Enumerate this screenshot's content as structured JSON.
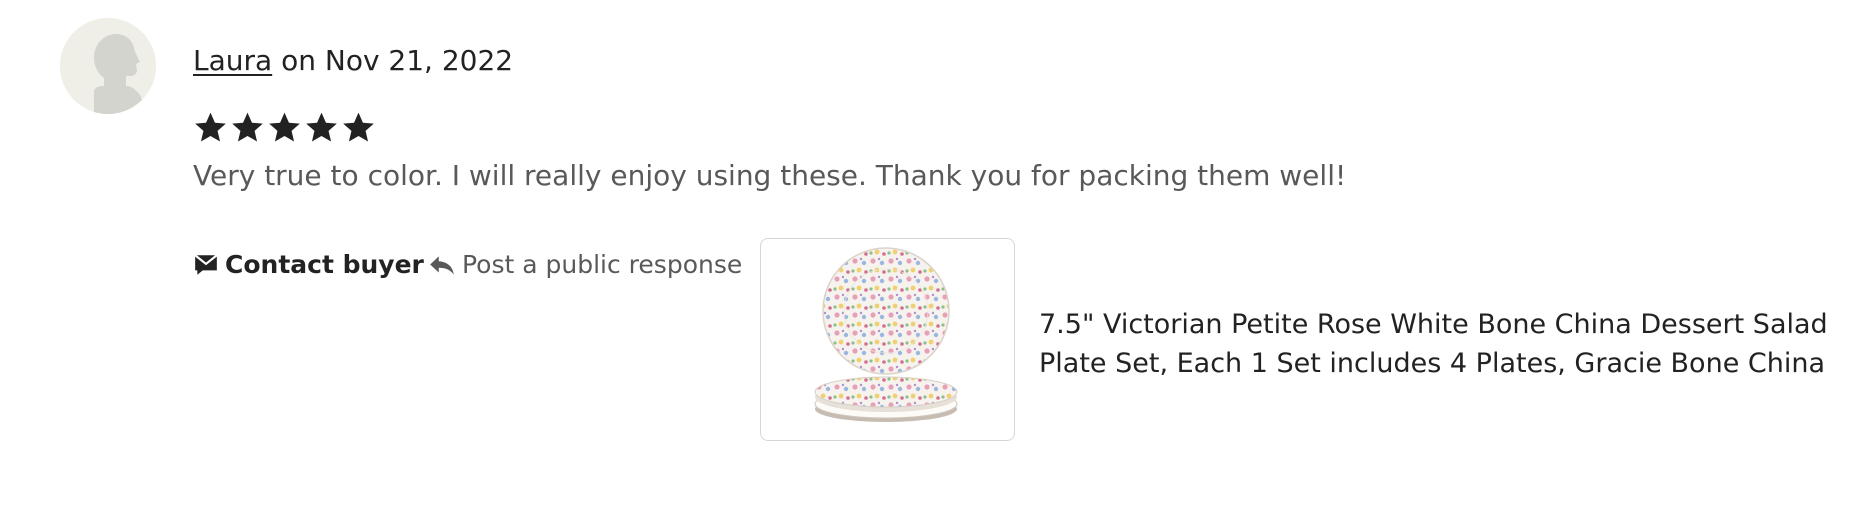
{
  "review": {
    "author": "Laura",
    "date_text": "on Nov 21, 2022",
    "rating": 5,
    "max_rating": 5,
    "text": "Very true to color. I will really enjoy using these. Thank you for packing them well!"
  },
  "actions": {
    "contact_label": "Contact buyer",
    "respond_label": "Post a public response"
  },
  "product": {
    "title_line1": "7.5\" Victorian Petite Rose White Bone China Dessert Salad",
    "title_line2": "Plate Set, Each 1 Set includes 4 Plates, Gracie Bone China"
  },
  "icons": {
    "avatar": "default-user-avatar-icon",
    "star": "star-icon",
    "contact": "message-icon",
    "respond": "reply-arrow-icon"
  },
  "colors": {
    "text": "#222222",
    "muted": "#595959",
    "border": "#d6d6d6",
    "star": "#222222"
  }
}
